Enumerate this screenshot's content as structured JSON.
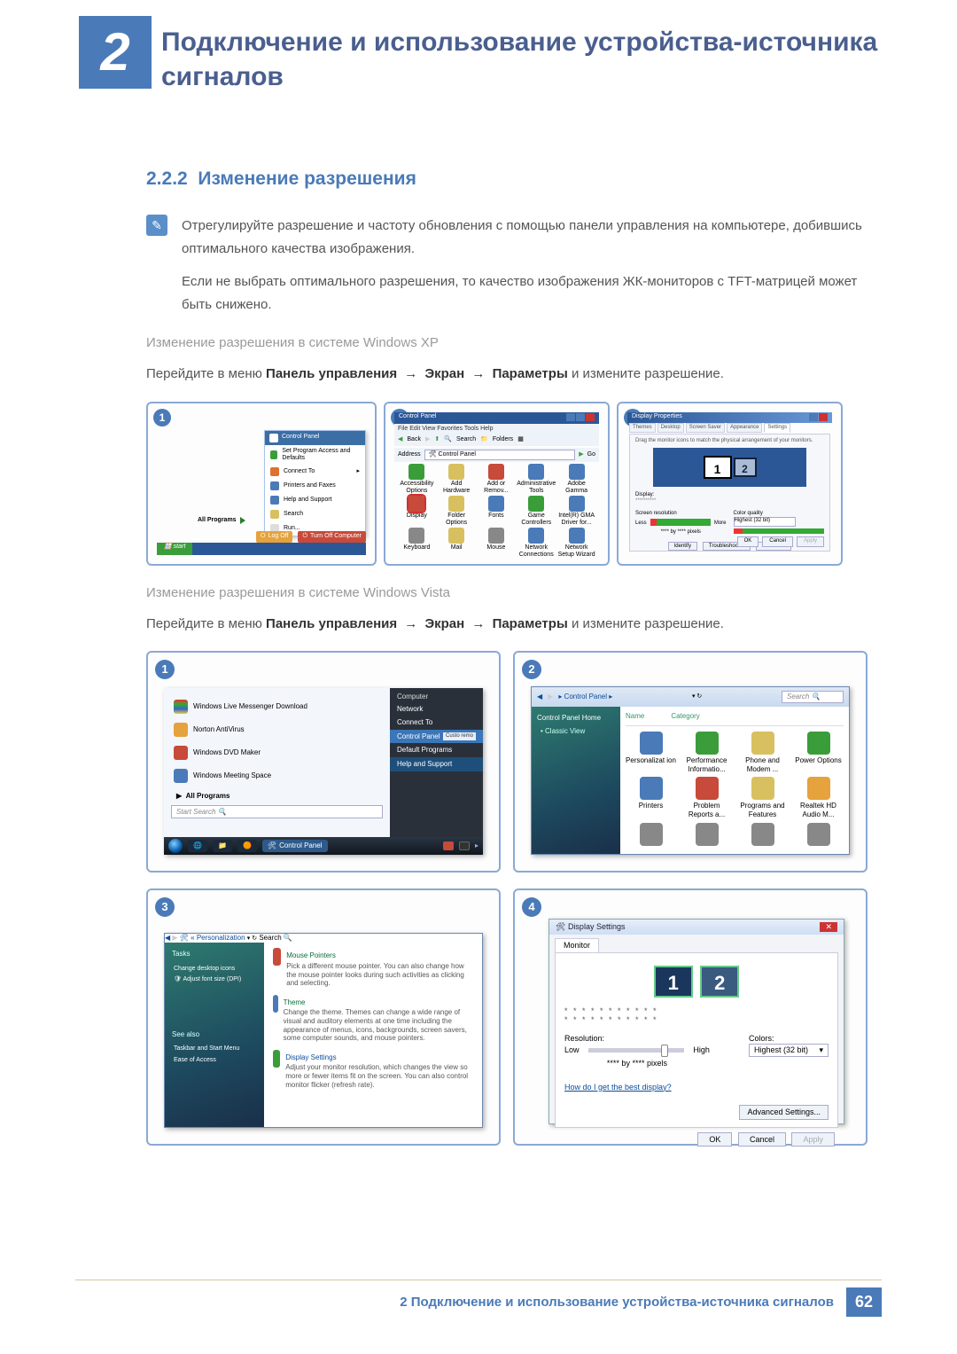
{
  "chapter": {
    "number": "2",
    "title": "Подключение и использование устройства-источника сигналов"
  },
  "section": {
    "number": "2.2.2",
    "title": "Изменение разрешения"
  },
  "note": {
    "p1": "Отрегулируйте разрешение и частоту обновления с помощью панели управления на компьютере, добившись оптимального качества изображения.",
    "p2": "Если не выбрать оптимального разрешения, то качество изображения ЖК-мониторов с TFT-матрицей может быть снижено."
  },
  "xp": {
    "heading": "Изменение разрешения в системе Windows XP",
    "instruction_pre": "Перейдите в меню ",
    "path1": "Панель управления",
    "arrow": "→",
    "path2": "Экран",
    "path3": "Параметры",
    "instruction_post": " и измените разрешение."
  },
  "vista": {
    "heading": "Изменение разрешения в системе Windows Vista",
    "instruction_pre": "Перейдите в меню ",
    "path1": "Панель управления",
    "path2": "Экран",
    "path3": "Параметры",
    "instruction_post": " и измените разрешение."
  },
  "badges": {
    "b1": "1",
    "b2": "2",
    "b3": "3",
    "b4": "4"
  },
  "xp1": {
    "cp": "Control Panel",
    "m1": "Set Program Access and Defaults",
    "m2": "Connect To",
    "m3": "Printers and Faxes",
    "m4": "Help and Support",
    "m5": "Search",
    "m6": "Run...",
    "allprog": "All Programs",
    "logoff": "Log Off",
    "turnoff": "Turn Off Computer",
    "start": "start"
  },
  "xp2": {
    "title": "Control Panel",
    "menubar": "File   Edit   View   Favorites   Tools   Help",
    "back": "Back",
    "search": "Search",
    "folders": "Folders",
    "address": "Address",
    "addr_val": "Control Panel",
    "go": "Go",
    "items": [
      "Accessibility Options",
      "Add Hardware",
      "Add or Remov...",
      "Administrative Tools",
      "Adobe Gamma",
      "Display",
      "Folder Options",
      "Fonts",
      "Game Controllers",
      "Intel(R) GMA Driver for...",
      "Keyboard",
      "Mail",
      "Mouse",
      "Network Connections",
      "Network Setup Wizard"
    ]
  },
  "xp3": {
    "title": "Display Properties",
    "tabs": [
      "Themes",
      "Desktop",
      "Screen Saver",
      "Appearance",
      "Settings"
    ],
    "drag": "Drag the monitor icons to match the physical arrangement of your monitors.",
    "mon1": "1",
    "mon2": "2",
    "display": "Display:",
    "disp_val": "**********",
    "screenres": "Screen resolution",
    "less": "Less",
    "more": "More",
    "colorq": "Color quality",
    "colorq_val": "Highest (32 bit)",
    "resval": "**** by **** pixels",
    "identify": "Identify",
    "troubleshoot": "Troubleshoot...",
    "advanced": "Advanced",
    "ok": "OK",
    "cancel": "Cancel",
    "apply": "Apply"
  },
  "v1": {
    "items": [
      "Windows Live Messenger Download",
      "Norton AntiVirus",
      "Windows DVD Maker",
      "Windows Meeting Space"
    ],
    "allprog": "All Programs",
    "search": "Start Search",
    "right_hdr": "Computer",
    "right": [
      "Network",
      "Connect To",
      "Control Panel",
      "Default Programs",
      "Help and Support"
    ],
    "cpside": "Custo remo",
    "taskbtn": "Control Panel"
  },
  "v2": {
    "crumb": "▸ Control Panel ▸",
    "search": "Search",
    "side_hdr": "Control Panel Home",
    "side_item": "Classic View",
    "cols": [
      "Name",
      "Category"
    ],
    "items": [
      "Personalizat ion",
      "Performance Informatio...",
      "Phone and Modem ...",
      "Power Options",
      "Printers",
      "Problem Reports a...",
      "Programs and Features",
      "Realtek HD Audio M..."
    ]
  },
  "v3": {
    "crumb": "« Personalization",
    "search": "Search",
    "side_hdr": "Tasks",
    "side": [
      "Change desktop icons",
      "Adjust font size (DPI)"
    ],
    "see": "See also",
    "see_items": [
      "Taskbar and Start Menu",
      "Ease of Access"
    ],
    "h1": "Mouse Pointers",
    "d1": "Pick a different mouse pointer. You can also change how the mouse pointer looks during such activities as clicking and selecting.",
    "h2": "Theme",
    "d2": "Change the theme. Themes can change a wide range of visual and auditory elements at one time including the appearance of menus, icons, backgrounds, screen savers, some computer sounds, and mouse pointers.",
    "h3": "Display Settings",
    "d3": "Adjust your monitor resolution, which changes the view so more or fewer items fit on the screen. You can also control monitor flicker (refresh rate)."
  },
  "v4": {
    "title": "Display Settings",
    "tab": "Monitor",
    "mon1": "1",
    "mon2": "2",
    "dots": "* * * * * * * * * * *\n* * * * * * * * * * *",
    "res": "Resolution:",
    "colors": "Colors:",
    "low": "Low",
    "high": "High",
    "resval": "**** by **** pixels",
    "colorval": "Highest (32 bit)",
    "link": "How do I get the best display?",
    "adv": "Advanced Settings...",
    "ok": "OK",
    "cancel": "Cancel",
    "apply": "Apply"
  },
  "footer": {
    "text": "2 Подключение и использование устройства-источника сигналов",
    "page": "62"
  }
}
